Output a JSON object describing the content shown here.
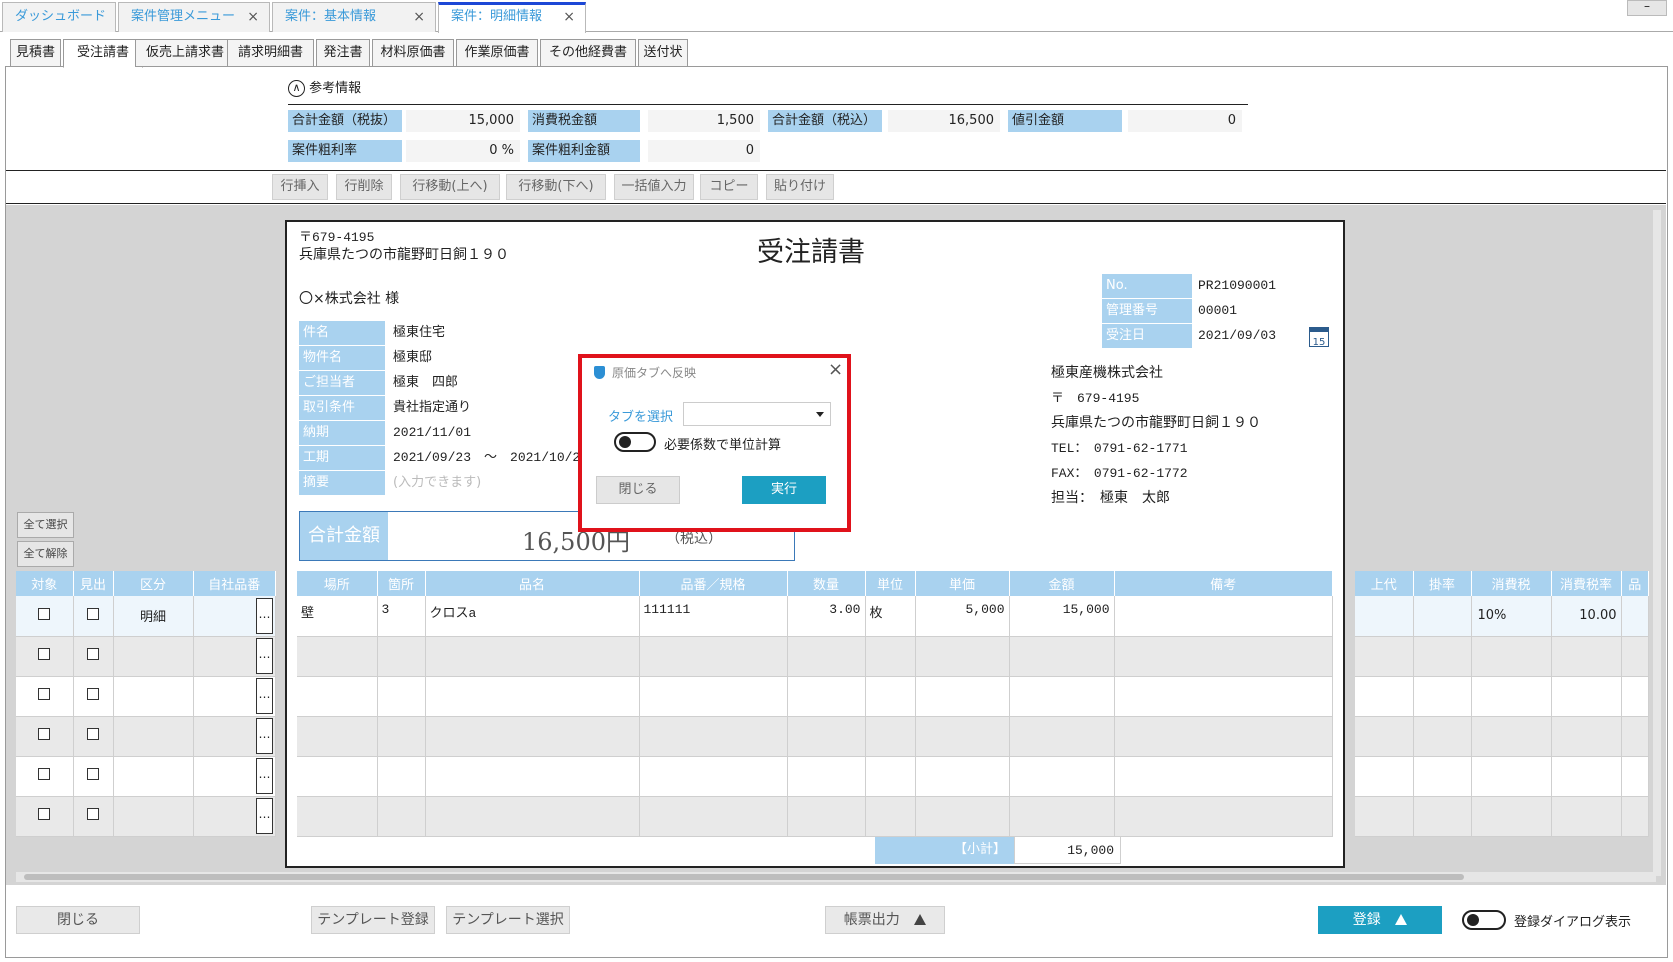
{
  "top_tabs": [
    {
      "label": "ダッシュボード",
      "closable": false
    },
    {
      "label": "案件管理メニュー",
      "closable": true
    },
    {
      "label": "案件：基本情報",
      "closable": true
    },
    {
      "label": "案件：明細情報",
      "closable": true,
      "active": true
    }
  ],
  "close_glyph": "×",
  "minimize_glyph": "–",
  "doc_tabs": [
    "見積書",
    "受注請書",
    "仮売上請求書",
    "請求明細書",
    "発注書",
    "材料原価書",
    "作業原価書",
    "その他経費書",
    "送付状"
  ],
  "ref_info": {
    "toggle_label": "参考情報",
    "row1": [
      {
        "label": "合計金額（税抜）",
        "value": "15,000"
      },
      {
        "label": "消費税金額",
        "value": "1,500"
      },
      {
        "label": "合計金額（税込）",
        "value": "16,500"
      },
      {
        "label": "値引金額",
        "value": "0"
      }
    ],
    "row2": [
      {
        "label": "案件粗利率",
        "value": "0 %"
      },
      {
        "label": "案件粗利金額",
        "value": "0"
      }
    ]
  },
  "toolbar": [
    "行挿入",
    "行削除",
    "行移動(上へ)",
    "行移動(下へ)",
    "一括値入力",
    "コピー",
    "貼り付け"
  ],
  "document": {
    "postal": "〒679-4195",
    "address": "兵庫県たつの市龍野町日飼１９０",
    "title": "受注請書",
    "customer": "〇×株式会社 様",
    "fields": [
      {
        "label": "件名",
        "value": "極東住宅"
      },
      {
        "label": "物件名",
        "value": "極東邸"
      },
      {
        "label": "ご担当者",
        "value": "極東　四郎"
      },
      {
        "label": "取引条件",
        "value": "貴社指定通り"
      },
      {
        "label": "納期",
        "value": "2021/11/01"
      },
      {
        "label": "工期",
        "value": "2021/09/23　～　2021/10/29"
      },
      {
        "label": "摘要",
        "value": "(入力できます)"
      }
    ],
    "meta": [
      {
        "label": "No.",
        "value": "PR21090001"
      },
      {
        "label": "管理番号",
        "value": "00001"
      },
      {
        "label": "受注日",
        "value": "2021/09/03"
      }
    ],
    "calendar_day": "15",
    "company": {
      "name": "極東産機株式会社",
      "postal": "〒　679-4195",
      "address": "兵庫県たつの市龍野町日飼１９０",
      "tel": "TEL：　0791-62-1771",
      "fax": "FAX：　0791-62-1772",
      "contact": "担当：　極東　太郎"
    },
    "total": {
      "label": "合計金額",
      "value": "16,500円",
      "suffix": "（税込）"
    },
    "subtotal": {
      "label": "【小計】",
      "value": "15,000"
    }
  },
  "left_buttons": {
    "select_all": "全て選択",
    "deselect_all": "全て解除"
  },
  "ellipsis": "…",
  "left_grid": {
    "headers": [
      "対象",
      "見出",
      "区分",
      "自社品番"
    ],
    "rows": [
      [
        "",
        "",
        "明細",
        ""
      ],
      [
        "",
        "",
        "",
        ""
      ],
      [
        "",
        "",
        "",
        ""
      ],
      [
        "",
        "",
        "",
        ""
      ],
      [
        "",
        "",
        "",
        ""
      ],
      [
        "",
        "",
        "",
        ""
      ]
    ]
  },
  "main_grid": {
    "headers": [
      "場所",
      "箇所",
      "品名",
      "品番／規格",
      "数量",
      "単位",
      "単価",
      "金額",
      "備考"
    ],
    "rows": [
      [
        "壁",
        "3",
        "クロスa",
        "111111",
        "3.00",
        "枚",
        "5,000",
        "15,000",
        ""
      ],
      [
        "",
        "",
        "",
        "",
        "",
        "",
        "",
        "",
        ""
      ],
      [
        "",
        "",
        "",
        "",
        "",
        "",
        "",
        "",
        ""
      ],
      [
        "",
        "",
        "",
        "",
        "",
        "",
        "",
        "",
        ""
      ],
      [
        "",
        "",
        "",
        "",
        "",
        "",
        "",
        "",
        ""
      ],
      [
        "",
        "",
        "",
        "",
        "",
        "",
        "",
        "",
        ""
      ]
    ]
  },
  "right_grid": {
    "headers": [
      "上代",
      "掛率",
      "消費税",
      "消費税率",
      "品"
    ],
    "rows": [
      [
        "",
        "",
        "10%",
        "10.00",
        ""
      ],
      [
        "",
        "",
        "",
        "",
        ""
      ],
      [
        "",
        "",
        "",
        "",
        ""
      ],
      [
        "",
        "",
        "",
        "",
        ""
      ],
      [
        "",
        "",
        "",
        "",
        ""
      ],
      [
        "",
        "",
        "",
        "",
        ""
      ]
    ]
  },
  "dialog": {
    "title": "原価タブへ反映",
    "tab_select_label": "タブを選択",
    "tab_select_value": "",
    "toggle_label": "必要係数で単位計算",
    "close_button": "閉じる",
    "run_button": "実行"
  },
  "bottom": {
    "close": "閉じる",
    "template_register": "テンプレート登録",
    "template_select": "テンプレート選択",
    "report_output": "帳票出力",
    "register": "登録",
    "dialog_toggle_label": "登録ダイアログ表示"
  },
  "colors": {
    "label_bg": "#a9d2ef",
    "accent": "#1c9fc2",
    "dialog_border": "#e0121b",
    "tab_text": "#3a9ad9"
  }
}
